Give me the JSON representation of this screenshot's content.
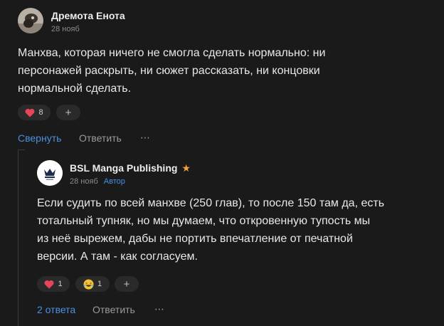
{
  "comments": [
    {
      "author": "Дремота Енота",
      "date": "28 нояб",
      "text_lines": [
        "Манхва, которая ничего не смогла сделать нормально: ни",
        "персонажей раскрыть, ни сюжет рассказать, ни концовки",
        "нормальной сделать."
      ],
      "reactions": [
        {
          "icon": "heart-icon",
          "count": "8"
        }
      ],
      "add_reaction_label": "+",
      "actions": {
        "collapse": "Свернуть",
        "reply": "Ответить",
        "more": "⋯"
      }
    },
    {
      "author": "BSL Manga Publishing",
      "author_star": "★",
      "date": "28 нояб",
      "badge": "Автор",
      "text_lines": [
        "Если судить по всей манхве (250 глав), то после 150 там да, есть",
        "тотальный тупняк, но мы думаем, что откровенную тупость мы",
        "из неё вырежем, дабы не портить впечатление от печатной",
        "версии. А там - как согласуем."
      ],
      "reactions": [
        {
          "icon": "heart-icon",
          "count": "1"
        },
        {
          "icon": "laughing-emoji-icon",
          "count": "1"
        }
      ],
      "add_reaction_label": "+",
      "actions": {
        "replies": "2 ответа",
        "reply": "Ответить",
        "more": "⋯"
      }
    }
  ],
  "colors": {
    "background": "#1a1a1a",
    "link": "#4a8fe0",
    "heart": "#e8455a",
    "star": "#f2a33a"
  }
}
